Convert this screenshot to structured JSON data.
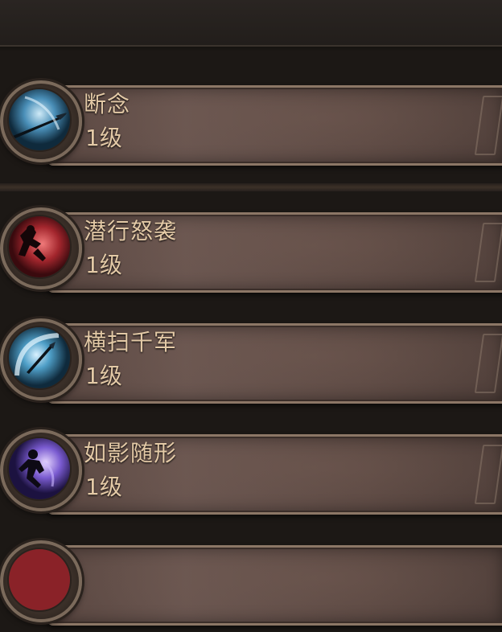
{
  "skills": [
    {
      "name": "断念",
      "level": "1级",
      "icon": "spear-throw-icon",
      "color": "#3f7fa8"
    },
    {
      "name": "潜行怒袭",
      "level": "1级",
      "icon": "shadow-rogue-icon",
      "color": "#a83a3f"
    },
    {
      "name": "横扫千军",
      "level": "1级",
      "icon": "sweep-slash-icon",
      "color": "#3d8ab0"
    },
    {
      "name": "如影随形",
      "level": "1级",
      "icon": "shadow-step-icon",
      "color": "#6a4fb6"
    },
    {
      "name": "",
      "level": "",
      "icon": "crimson-skill-icon",
      "color": "#a83a3f"
    }
  ]
}
